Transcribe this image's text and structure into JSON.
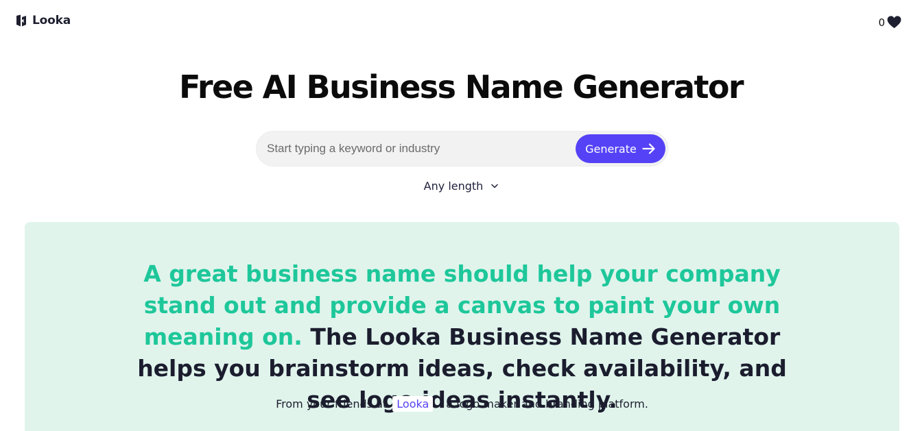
{
  "header": {
    "logo_text": "Looka",
    "favorites_count": "0"
  },
  "hero": {
    "title": "Free AI Business Name Generator",
    "search_placeholder": "Start typing a keyword or industry",
    "generate_label": "Generate",
    "length_selected": "Any length"
  },
  "info": {
    "accent_text": "A great business name should help your company stand out and provide a canvas to paint your own meaning on.",
    "body_text": "The Looka Business Name Generator helps you brainstorm ideas, check availability, and see logo ideas instantly.",
    "credit_prefix": "From your friends at",
    "credit_link": "Looka",
    "credit_suffix": "- a logo maker and branding platform."
  },
  "icons": {
    "logo": "looka-logo-icon",
    "favorites": "heart-icon",
    "generate": "arrow-right-icon",
    "length": "chevron-down-icon"
  },
  "colors": {
    "accent": "#5542f6",
    "panel_bg": "#e0f4ec",
    "highlight_text": "#1ec79a"
  }
}
